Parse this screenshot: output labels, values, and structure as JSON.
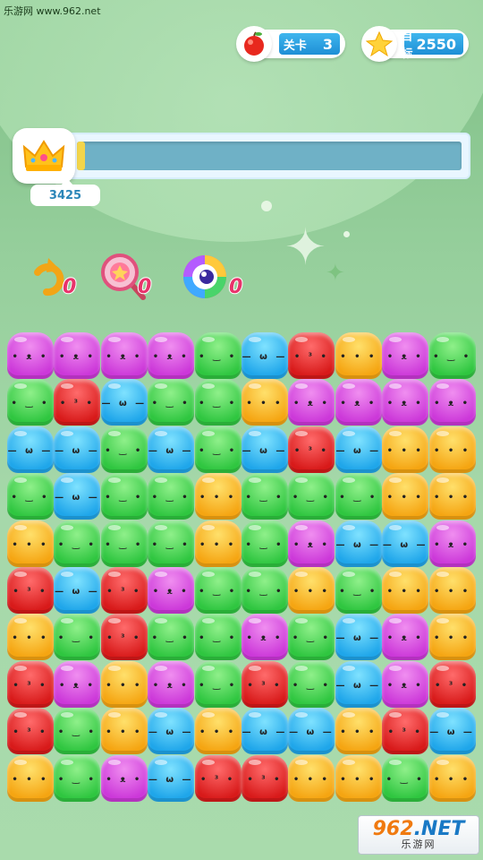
{
  "watermark": "乐游网 www.962.net",
  "level": {
    "icon": "apple-icon",
    "label": "关卡",
    "value": "3"
  },
  "target": {
    "icon": "star-icon",
    "label": "目标",
    "value": "2550"
  },
  "score": {
    "value": "3425",
    "icon": "crown-icon",
    "progress_fraction": 0.02
  },
  "tools": [
    {
      "name": "undo-arrow-icon",
      "count": "0"
    },
    {
      "name": "magnifier-lollipop-icon",
      "count": "0"
    },
    {
      "name": "rainbow-eye-icon",
      "count": "0"
    }
  ],
  "colors": {
    "pink": "#d94fe0",
    "green": "#3ccf4a",
    "red": "#e02525",
    "yellow": "#f7b51c",
    "blue": "#2db3ef"
  },
  "board": {
    "rows": 10,
    "cols": 10,
    "grid": [
      [
        "pink",
        "pink",
        "pink",
        "pink",
        "green",
        "blue",
        "red",
        "yellow",
        "pink",
        "green"
      ],
      [
        "green",
        "red",
        "blue",
        "green",
        "green",
        "yellow",
        "pink",
        "pink",
        "pink",
        "pink"
      ],
      [
        "blue",
        "blue",
        "green",
        "blue",
        "green",
        "blue",
        "red",
        "blue",
        "yellow",
        "yellow"
      ],
      [
        "green",
        "blue",
        "green",
        "green",
        "yellow",
        "green",
        "green",
        "green",
        "yellow",
        "yellow"
      ],
      [
        "yellow",
        "green",
        "green",
        "green",
        "yellow",
        "green",
        "pink",
        "blue",
        "blue",
        "pink"
      ],
      [
        "red",
        "blue",
        "red",
        "pink",
        "green",
        "green",
        "yellow",
        "green",
        "yellow",
        "yellow"
      ],
      [
        "yellow",
        "green",
        "red",
        "green",
        "green",
        "pink",
        "green",
        "blue",
        "pink",
        "yellow"
      ],
      [
        "red",
        "pink",
        "yellow",
        "pink",
        "green",
        "red",
        "green",
        "blue",
        "pink",
        "red"
      ],
      [
        "red",
        "green",
        "yellow",
        "blue",
        "yellow",
        "blue",
        "blue",
        "yellow",
        "red",
        "blue"
      ],
      [
        "yellow",
        "green",
        "pink",
        "blue",
        "red",
        "red",
        "yellow",
        "yellow",
        "green",
        "yellow"
      ]
    ]
  },
  "site_logo": {
    "line1_a": "962",
    "line1_b": ".NET",
    "line2": "乐游网"
  }
}
